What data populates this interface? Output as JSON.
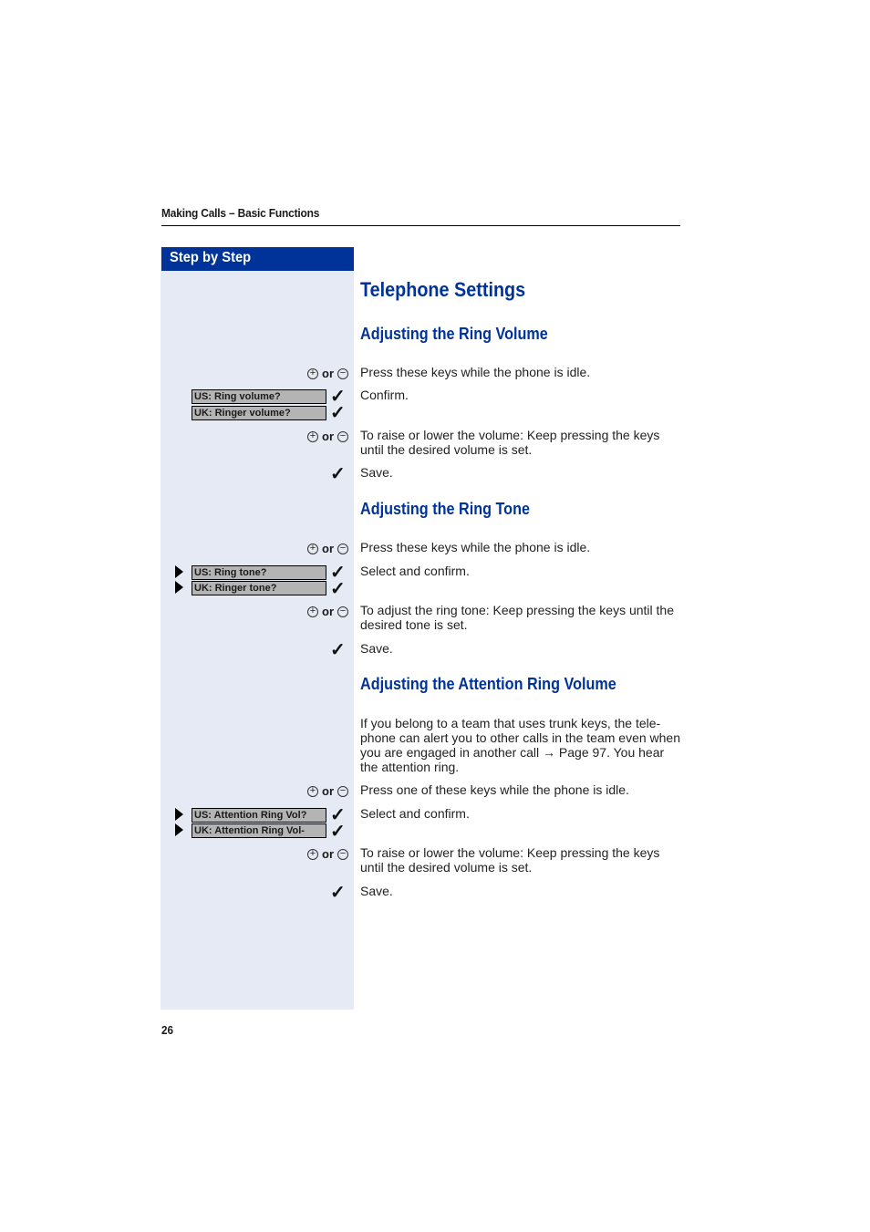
{
  "header": {
    "running_title": "Making Calls – Basic Functions"
  },
  "sidebar": {
    "heading": "Step by Step"
  },
  "page": {
    "title": "Telephone Settings",
    "number": "26"
  },
  "keys": {
    "plus": "+",
    "minus": "−",
    "or": "or",
    "check": "✓"
  },
  "sections": [
    {
      "title": "Adjusting the Ring Volume",
      "steps": [
        {
          "text": "Press these keys while the phone is idle."
        },
        {
          "text": "Confirm.",
          "displays": [
            "US: Ring volume?",
            "UK: Ringer volume?"
          ]
        },
        {
          "text": "To raise or lower the volume: Keep pressing the keys until the desired volume is set."
        },
        {
          "text": "Save."
        }
      ]
    },
    {
      "title": "Adjusting the Ring Tone",
      "steps": [
        {
          "text": "Press these keys while the phone is idle."
        },
        {
          "text": "Select and confirm.",
          "displays": [
            "US: Ring tone?",
            "UK: Ringer tone?"
          ]
        },
        {
          "text": "To adjust the ring tone: Keep pressing the keys until the desired tone is set."
        },
        {
          "text": "Save."
        }
      ]
    },
    {
      "title": "Adjusting the Attention Ring Volume",
      "intro": "If you belong to a team that uses trunk keys, the tele-phone can alert you to other calls in the team even when you are engaged in another call → Page 97. You hear the attention ring.",
      "steps": [
        {
          "text": "Press one of these keys while the phone is idle."
        },
        {
          "text": "Select and confirm.",
          "displays": [
            "US: Attention Ring Vol?",
            "UK: Attention Ring Vol-"
          ]
        },
        {
          "text": "To raise or lower the volume: Keep pressing the keys until the desired volume is set."
        },
        {
          "text": "Save."
        }
      ]
    }
  ]
}
